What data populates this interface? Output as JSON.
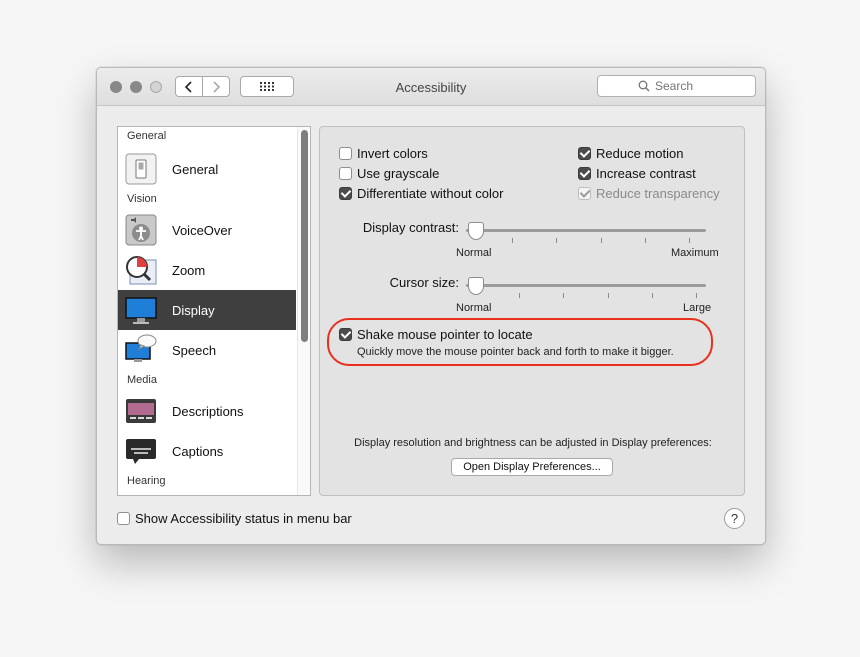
{
  "window": {
    "title": "Accessibility"
  },
  "toolbar": {
    "search_placeholder": "Search"
  },
  "sidebar": {
    "sections": {
      "general": "General",
      "vision": "Vision",
      "media": "Media",
      "hearing": "Hearing"
    },
    "items": [
      {
        "label": "General",
        "icon": "general-switch-icon"
      },
      {
        "label": "VoiceOver",
        "icon": "voiceover-icon"
      },
      {
        "label": "Zoom",
        "icon": "zoom-icon"
      },
      {
        "label": "Display",
        "icon": "display-icon",
        "selected": true
      },
      {
        "label": "Speech",
        "icon": "speech-icon"
      },
      {
        "label": "Descriptions",
        "icon": "descriptions-icon"
      },
      {
        "label": "Captions",
        "icon": "captions-icon"
      }
    ]
  },
  "display": {
    "options": {
      "invert_colors": {
        "label": "Invert colors",
        "checked": false
      },
      "use_grayscale": {
        "label": "Use grayscale",
        "checked": false
      },
      "differentiate": {
        "label": "Differentiate without color",
        "checked": true
      },
      "reduce_motion": {
        "label": "Reduce motion",
        "checked": true
      },
      "increase_contrast": {
        "label": "Increase contrast",
        "checked": true
      },
      "reduce_transparency": {
        "label": "Reduce transparency",
        "checked": true,
        "disabled": true
      }
    },
    "contrast": {
      "label": "Display contrast:",
      "min_label": "Normal",
      "max_label": "Maximum",
      "value": 0
    },
    "cursor": {
      "label": "Cursor size:",
      "min_label": "Normal",
      "max_label": "Large",
      "value": 0
    },
    "shake": {
      "label": "Shake mouse pointer to locate",
      "description": "Quickly move the mouse pointer back and forth to make it bigger.",
      "checked": true,
      "highlight_color": "#e8301c"
    },
    "info_text": "Display resolution and brightness can be adjusted in Display preferences:",
    "open_prefs_button": "Open Display Preferences..."
  },
  "footer": {
    "status_label": "Show Accessibility status in menu bar",
    "status_checked": false,
    "help": "?"
  }
}
